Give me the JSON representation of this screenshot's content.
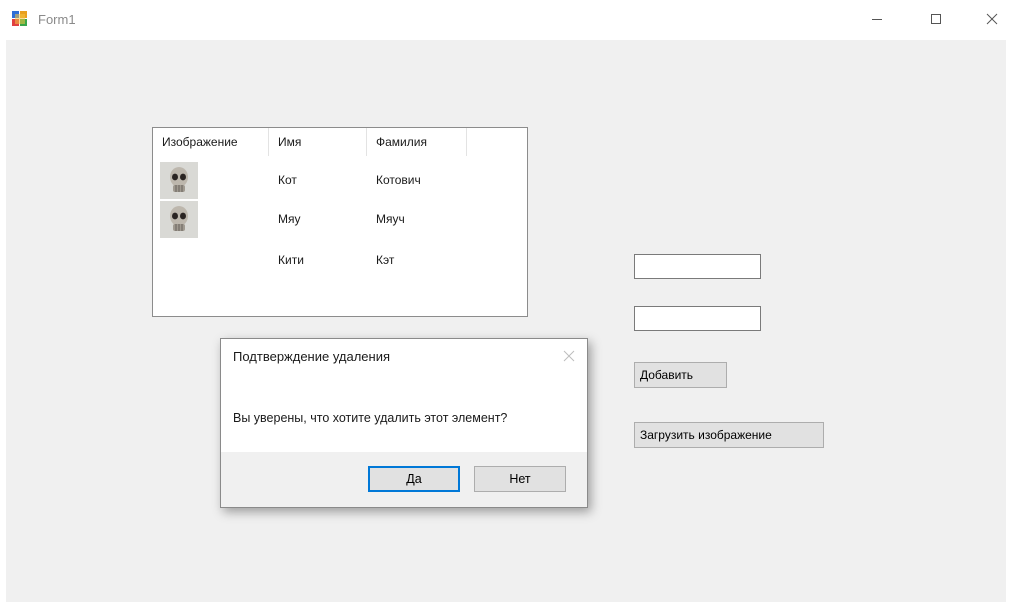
{
  "window": {
    "title": "Form1",
    "minimize_icon": "minimize-icon",
    "maximize_icon": "maximize-icon",
    "close_icon": "close-icon"
  },
  "listview": {
    "columns": [
      "Изображение",
      "Имя",
      "Фамилия"
    ],
    "rows": [
      {
        "image": "skull-image",
        "first_name": "Кот",
        "last_name": "Котович"
      },
      {
        "image": "skull-image",
        "first_name": "Мяу",
        "last_name": "Мяуч"
      },
      {
        "image": "",
        "first_name": "Кити",
        "last_name": "Кэт"
      }
    ]
  },
  "form": {
    "textbox1_value": "",
    "textbox2_value": "",
    "add_button": "Добавить",
    "load_image_button": "Загрузить изображение"
  },
  "dialog": {
    "title": "Подтверждение удаления",
    "message": "Вы уверены, что хотите удалить этот элемент?",
    "yes_button": "Да",
    "no_button": "Нет"
  },
  "colors": {
    "client_background": "#f0f0f0",
    "button_face": "#e1e1e1",
    "default_button_border": "#0078d7"
  }
}
